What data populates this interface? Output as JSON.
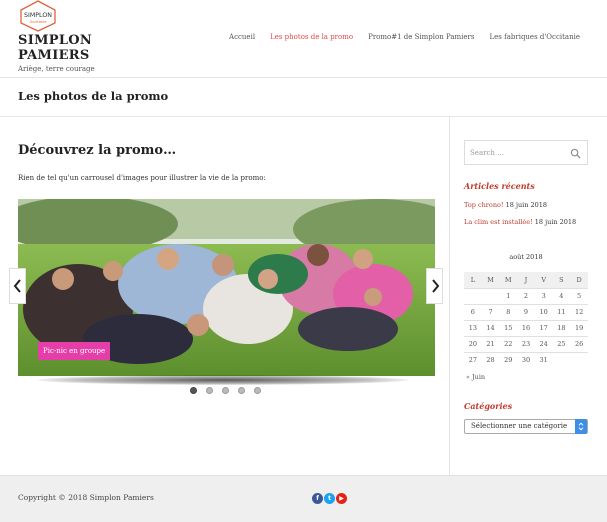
{
  "site": {
    "logo_text": "SIMPLON",
    "logo_subtext": "Occitanie",
    "title": "SIMPLON PAMIERS",
    "tagline": "Ariège, terre courage"
  },
  "nav": {
    "items": [
      "Accueil",
      "Les photos de la promo",
      "Promo#1 de Simplon Pamiers",
      "Les fabriques d'Occitanie"
    ],
    "active_index": 1
  },
  "page": {
    "title": "Les photos de la promo",
    "heading": "Découvrez la promo…",
    "intro": "Rien de tel qu'un carrousel d'images pour illustrer la vie de la promo:"
  },
  "carousel": {
    "caption": "Pic-nic en groupe",
    "slide_count": 5,
    "active_slide": 1
  },
  "sidebar": {
    "search_placeholder": "Search …",
    "recent_title": "Articles récents",
    "posts": [
      {
        "title": "Top chrono!",
        "date": "18 juin 2018"
      },
      {
        "title": "La clim est installée!",
        "date": "18 juin 2018"
      }
    ],
    "calendar": {
      "caption": "août 2018",
      "days": [
        "L",
        "M",
        "M",
        "J",
        "V",
        "S",
        "D"
      ],
      "weeks": [
        [
          "",
          "",
          "1",
          "2",
          "3",
          "4",
          "5"
        ],
        [
          "6",
          "7",
          "8",
          "9",
          "10",
          "11",
          "12"
        ],
        [
          "13",
          "14",
          "15",
          "16",
          "17",
          "18",
          "19"
        ],
        [
          "20",
          "21",
          "22",
          "23",
          "24",
          "25",
          "26"
        ],
        [
          "27",
          "28",
          "29",
          "30",
          "31",
          "",
          ""
        ]
      ],
      "prev": "« Juin"
    },
    "categories_title": "Catégories",
    "categories_select": "Sélectionner une catégorie"
  },
  "footer": {
    "copyright": "Copyright © 2018 Simplon Pamiers"
  },
  "colors": {
    "accent": "#e0484d",
    "widget_title": "#c0392b",
    "caption_bg": "#e63ea8",
    "facebook": "#3b5998",
    "twitter": "#1da1f2",
    "youtube": "#e62117"
  }
}
